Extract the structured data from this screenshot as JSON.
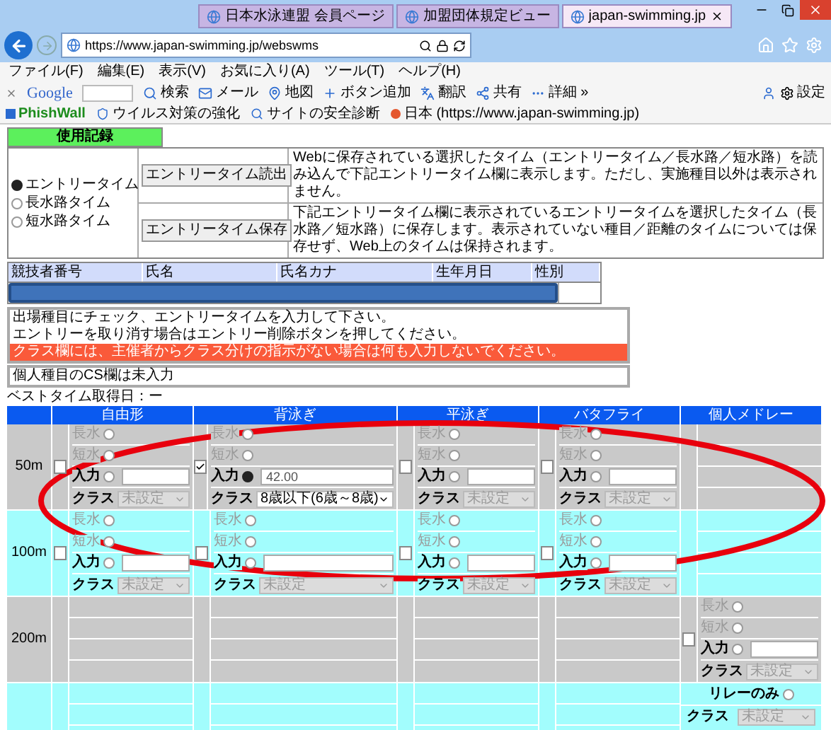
{
  "window": {
    "tabs": [
      {
        "label": "日本水泳連盟 会員ページ",
        "selected": false
      },
      {
        "label": "加盟団体規定ビュー",
        "selected": false
      },
      {
        "label": "japan-swimming.jp",
        "selected": true
      }
    ],
    "address": "https://www.japan-swimming.jp/webswms"
  },
  "menu": [
    "ファイル(F)",
    "編集(E)",
    "表示(V)",
    "お気に入り(A)",
    "ツール(T)",
    "ヘルプ(H)"
  ],
  "google_toolbar": {
    "logo": "Google",
    "items": [
      {
        "kind": "search",
        "label": "検索"
      },
      {
        "kind": "mail",
        "label": "メール"
      },
      {
        "kind": "map",
        "label": "地図"
      },
      {
        "kind": "add",
        "label": "ボタン追加"
      },
      {
        "kind": "translate",
        "label": "翻訳"
      },
      {
        "kind": "share",
        "label": "共有"
      },
      {
        "kind": "more",
        "label": "詳細 »"
      }
    ],
    "settings": "設定"
  },
  "favorites": [
    {
      "kind": "brand",
      "label": "PhishWall"
    },
    {
      "kind": "shield",
      "label": "ウイルス対策の強化"
    },
    {
      "kind": "search",
      "label": "サイトの安全診断"
    },
    {
      "kind": "site",
      "label": "日本 (https://www.japan-swimming.jp)"
    }
  ],
  "usage": {
    "title": "使用記録",
    "options": [
      {
        "label": "エントリータイム",
        "selected": true
      },
      {
        "label": "長水路タイム",
        "selected": false
      },
      {
        "label": "短水路タイム",
        "selected": false
      }
    ],
    "actions": [
      {
        "button": "エントリータイム読出",
        "description": "Webに保存されている選択したタイム（エントリータイム／長水路／短水路）を読み込んで下記エントリータイム欄に表示します。ただし、実施種目以外は表示されません。"
      },
      {
        "button": "エントリータイム保存",
        "description": "下記エントリータイム欄に表示されているエントリータイムを選択したタイム（長水路／短水路）に保存します。表示されていない種目／距離のタイムについては保存せず、Web上のタイムは保持されます。"
      }
    ]
  },
  "athlete": {
    "columns": [
      "競技者番号",
      "氏名",
      "氏名カナ",
      "生年月日",
      "性別"
    ]
  },
  "notes": [
    {
      "kind": "normal",
      "text": "出場種目にチェック、エントリータイムを入力して下さい。"
    },
    {
      "kind": "normal",
      "text": "エントリーを取り消す場合はエントリー削除ボタンを押してください。"
    },
    {
      "kind": "warning",
      "text": "クラス欄には、主催者からクラス分けの指示がない場合は何も入力しないでください。"
    }
  ],
  "cs_notice": "個人種目のCS欄は未入力",
  "best_time": "ベストタイム取得日：ー",
  "events": {
    "strokes": [
      "自由形",
      "背泳ぎ",
      "平泳ぎ",
      "バタフライ",
      "個人メドレー"
    ],
    "rows": [
      {
        "distance": "50m",
        "cells": [
          {
            "kind": "entry",
            "checked": false,
            "options": [
              {
                "label": "長水",
                "selected": false,
                "disabled": true
              },
              {
                "label": "短水",
                "selected": false,
                "disabled": true
              },
              {
                "label": "入力",
                "selected": false,
                "disabled": false
              }
            ],
            "class_label": "クラス",
            "class_value": "未設定"
          },
          {
            "kind": "entry",
            "checked": true,
            "options": [
              {
                "label": "長水",
                "selected": false,
                "disabled": true
              },
              {
                "label": "短水",
                "selected": false,
                "disabled": true
              },
              {
                "label": "入力",
                "selected": true,
                "disabled": false
              }
            ],
            "value": "42.00",
            "class_label": "クラス",
            "class_value": "8歳以下(6歳～8歳)"
          },
          {
            "kind": "entry",
            "checked": false,
            "options": [
              {
                "label": "長水",
                "selected": false,
                "disabled": true
              },
              {
                "label": "短水",
                "selected": false,
                "disabled": true
              },
              {
                "label": "入力",
                "selected": false,
                "disabled": false
              }
            ],
            "class_label": "クラス",
            "class_value": "未設定"
          },
          {
            "kind": "entry",
            "checked": false,
            "options": [
              {
                "label": "長水",
                "selected": false,
                "disabled": true
              },
              {
                "label": "短水",
                "selected": false,
                "disabled": true
              },
              {
                "label": "入力",
                "selected": false,
                "disabled": false
              }
            ],
            "class_label": "クラス",
            "class_value": "未設定"
          },
          {
            "kind": "empty"
          }
        ]
      },
      {
        "distance": "100m",
        "cells": [
          {
            "kind": "entry",
            "checked": false,
            "options": [
              {
                "label": "長水",
                "selected": false,
                "disabled": true
              },
              {
                "label": "短水",
                "selected": false,
                "disabled": true
              },
              {
                "label": "入力",
                "selected": false,
                "disabled": false
              }
            ],
            "class_label": "クラス",
            "class_value": "未設定"
          },
          {
            "kind": "entry",
            "checked": false,
            "options": [
              {
                "label": "長水",
                "selected": false,
                "disabled": true
              },
              {
                "label": "短水",
                "selected": false,
                "disabled": true
              },
              {
                "label": "入力",
                "selected": false,
                "disabled": false
              }
            ],
            "class_label": "クラス",
            "class_value": "未設定"
          },
          {
            "kind": "entry",
            "checked": false,
            "options": [
              {
                "label": "長水",
                "selected": false,
                "disabled": true
              },
              {
                "label": "短水",
                "selected": false,
                "disabled": true
              },
              {
                "label": "入力",
                "selected": false,
                "disabled": false
              }
            ],
            "class_label": "クラス",
            "class_value": "未設定"
          },
          {
            "kind": "entry",
            "checked": false,
            "options": [
              {
                "label": "長水",
                "selected": false,
                "disabled": true
              },
              {
                "label": "短水",
                "selected": false,
                "disabled": true
              },
              {
                "label": "入力",
                "selected": false,
                "disabled": false
              }
            ],
            "class_label": "クラス",
            "class_value": "未設定"
          },
          {
            "kind": "empty"
          }
        ]
      },
      {
        "distance": "200m",
        "cells": [
          {
            "kind": "empty"
          },
          {
            "kind": "empty"
          },
          {
            "kind": "empty"
          },
          {
            "kind": "empty"
          },
          {
            "kind": "entry",
            "checked": false,
            "options": [
              {
                "label": "長水",
                "selected": false,
                "disabled": true
              },
              {
                "label": "短水",
                "selected": false,
                "disabled": true
              },
              {
                "label": "入力",
                "selected": false,
                "disabled": false
              }
            ],
            "class_label": "クラス",
            "class_value": "未設定"
          }
        ]
      },
      {
        "cells": [
          {
            "kind": "empty"
          },
          {
            "kind": "empty"
          },
          {
            "kind": "empty"
          },
          {
            "kind": "empty"
          },
          {
            "kind": "relay",
            "label": "リレーのみ",
            "checked": false,
            "class_label": "クラス",
            "class_value": "未設定"
          }
        ]
      }
    ]
  }
}
